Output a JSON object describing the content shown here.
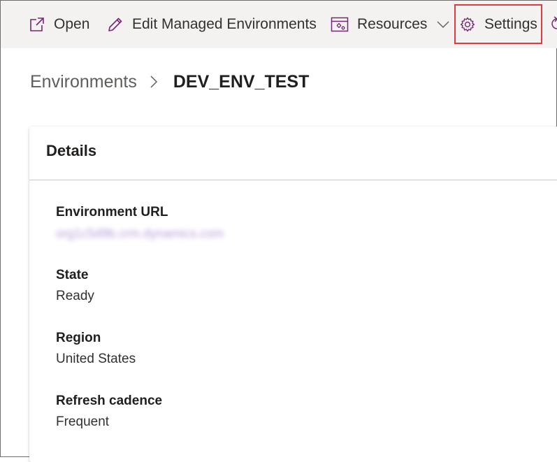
{
  "toolbar": {
    "open_label": "Open",
    "open_icon": "open-external-icon",
    "edit_label": "Edit Managed Environments",
    "edit_icon": "pencil-icon",
    "resources_label": "Resources",
    "resources_icon": "resources-icon",
    "settings_label": "Settings",
    "settings_icon": "gear-icon",
    "icon_color": "#742774"
  },
  "breadcrumb": {
    "parent": "Environments",
    "current": "DEV_ENV_TEST"
  },
  "details": {
    "title": "Details",
    "fields": [
      {
        "label": "Environment URL",
        "value": "org1c5d9b.crm.dynamics.com"
      },
      {
        "label": "State",
        "value": "Ready"
      },
      {
        "label": "Region",
        "value": "United States"
      },
      {
        "label": "Refresh cadence",
        "value": "Frequent"
      }
    ]
  },
  "colors": {
    "accent": "#742774",
    "highlight_border": "#e0393e",
    "command_bar_bg": "#f3f2f1"
  }
}
